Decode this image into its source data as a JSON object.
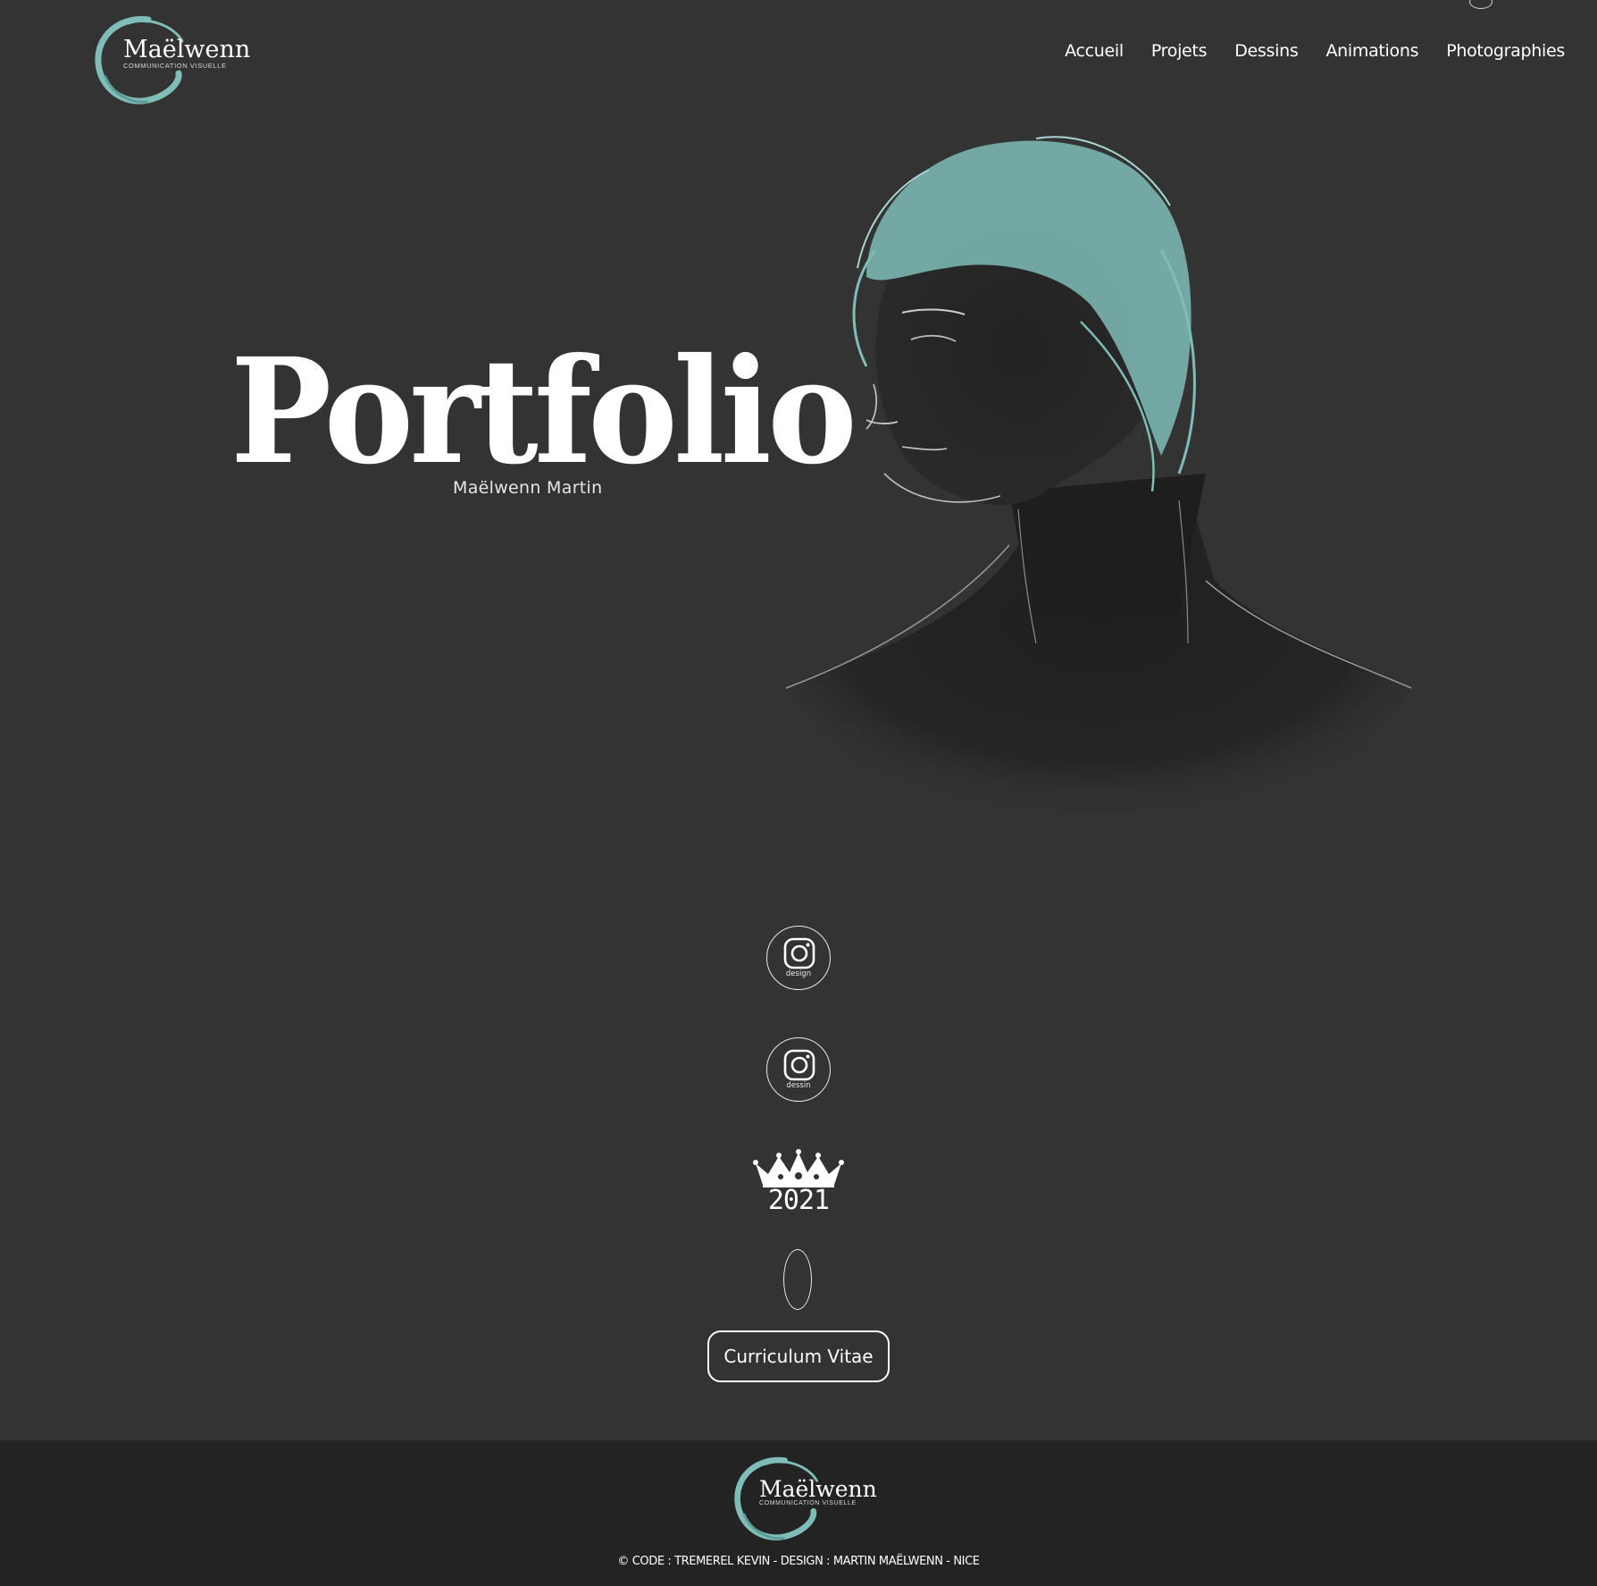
{
  "brand": {
    "name": "Maëlwenn",
    "tagline": "COMMUNICATION VISUELLE",
    "accent_color": "#7fbdb8"
  },
  "nav": {
    "items": [
      "Accueil",
      "Projets",
      "Dessins",
      "Animations",
      "Photographies"
    ]
  },
  "hero": {
    "title": "Portfolio",
    "subtitle": "Maëlwenn Martin",
    "image_icon": "portrait-sketch"
  },
  "social": {
    "design": {
      "icon": "instagram-icon",
      "caption": "design"
    },
    "dessin": {
      "icon": "instagram-icon",
      "caption": "dessin"
    },
    "badge": {
      "icon": "crown-icon",
      "year": "2021"
    }
  },
  "cv_button": {
    "label": "Curriculum Vitae"
  },
  "footer": {
    "copyright": "© CODE : TREMEREL KEVIN - DESIGN : MARTIN MAËLWENN - NICE"
  }
}
